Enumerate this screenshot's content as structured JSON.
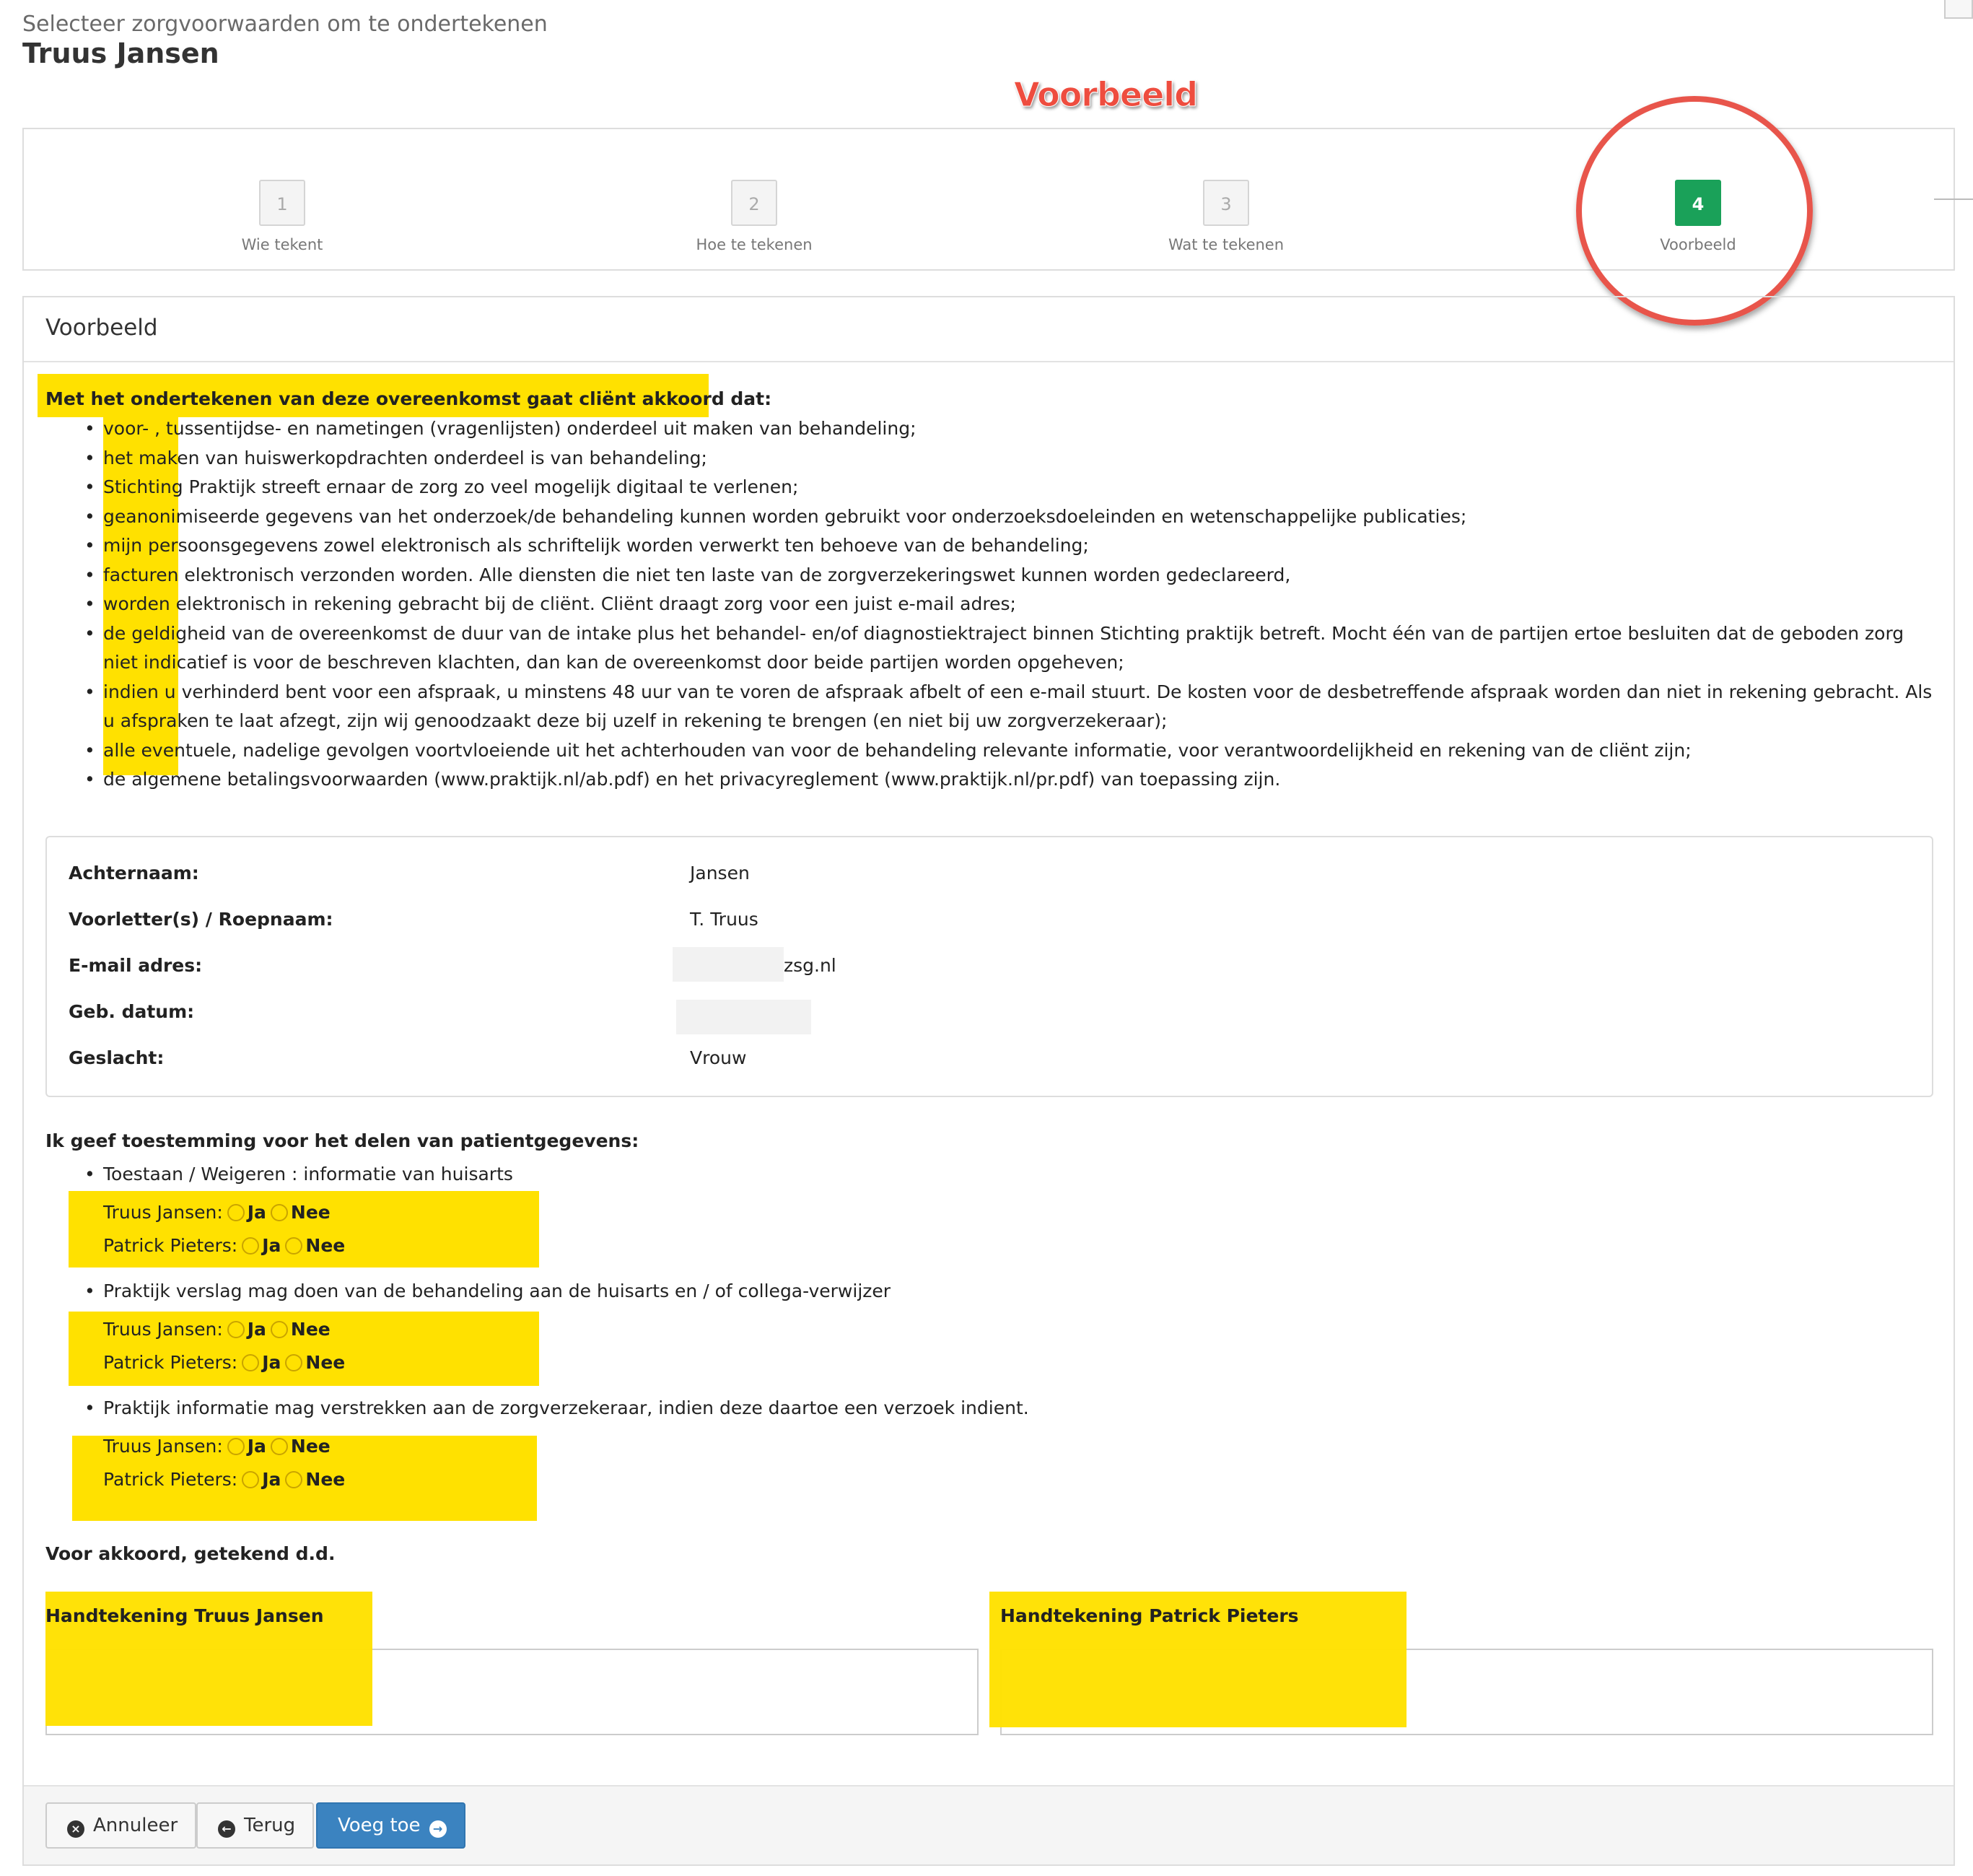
{
  "header": {
    "subtitle": "Selecteer zorgvoorwaarden om te ondertekenen",
    "title": "Truus Jansen",
    "annotation": "Voorbeeld"
  },
  "steps": [
    {
      "number": "1",
      "label": "Wie tekent"
    },
    {
      "number": "2",
      "label": "Hoe te tekenen"
    },
    {
      "number": "3",
      "label": "Wat te tekenen"
    },
    {
      "number": "4",
      "label": "Voorbeeld"
    }
  ],
  "panel": {
    "title": "Voorbeeld",
    "intro": "Met het ondertekenen van deze overeenkomst gaat cliënt akkoord dat:",
    "clauses": [
      "voor- , tussentijdse- en nametingen (vragenlijsten) onderdeel uit maken van behandeling;",
      "het maken van huiswerkopdrachten onderdeel is van behandeling;",
      "Stichting Praktijk streeft ernaar de zorg zo veel mogelijk digitaal te verlenen;",
      "geanonimiseerde gegevens van het onderzoek/de behandeling kunnen worden gebruikt voor onderzoeksdoeleinden en wetenschappelijke publicaties;",
      "mijn persoonsgegevens zowel elektronisch als schriftelijk worden verwerkt ten behoeve van de behandeling;",
      "facturen elektronisch verzonden worden. Alle diensten die niet ten laste van de zorgverzekeringswet kunnen worden gedeclareerd,",
      "worden elektronisch in rekening gebracht bij de cliënt. Cliënt draagt zorg voor een juist e-mail adres;",
      "de geldigheid van de overeenkomst de duur van de intake plus het behandel- en/of diagnostiektraject binnen Stichting praktijk betreft. Mocht één van de partijen ertoe besluiten dat de geboden zorg niet indicatief is voor de beschreven klachten, dan kan de overeenkomst door beide partijen worden opgeheven;",
      "indien u verhinderd bent voor een afspraak, u minstens 48 uur van te voren de afspraak afbelt of een e-mail stuurt. De kosten voor de desbetreffende afspraak worden dan niet in rekening gebracht. Als u afspraken te laat afzegt, zijn wij genoodzaakt deze bij uzelf in rekening te brengen (en niet bij uw zorgverzekeraar);",
      "alle eventuele, nadelige gevolgen voortvloeiende uit het achterhouden van voor de behandeling relevante informatie, voor verantwoordelijkheid en rekening van de cliënt zijn;",
      "de algemene betalingsvoorwaarden (www.praktijk.nl/ab.pdf) en het privacyreglement (www.praktijk.nl/pr.pdf) van toepassing zijn."
    ]
  },
  "client_info": [
    {
      "label": "Achternaam:",
      "value": "Jansen"
    },
    {
      "label": "Voorletter(s) / Roepnaam:",
      "value": "T. Truus"
    },
    {
      "label": "E-mail adres:",
      "value": "zsg.nl"
    },
    {
      "label": "Geb. datum:",
      "value": ""
    },
    {
      "label": "Geslacht:",
      "value": "Vrouw"
    }
  ],
  "consent": {
    "title": "Ik geef toestemming voor het delen van patientgegevens:",
    "items": [
      {
        "text": "Toestaan / Weigeren : informatie van huisarts"
      },
      {
        "text": "Praktijk verslag mag doen van de behandeling aan de huisarts en / of collega-verwijzer"
      },
      {
        "text": "Praktijk informatie mag verstrekken aan de zorgverzekeraar, indien deze daartoe een verzoek indient."
      }
    ],
    "persons": [
      "Truus Jansen:",
      "Patrick Pieters:"
    ],
    "yes": "Ja",
    "no": "Nee"
  },
  "signatures": {
    "agree": "Voor akkoord, getekend d.d.",
    "left_label": "Handtekening Truus Jansen",
    "right_label": "Handtekening Patrick Pieters"
  },
  "buttons": {
    "cancel": "Annuleer",
    "back": "Terug",
    "add": "Voeg toe"
  },
  "colors": {
    "highlight": "#ffe100",
    "active_step": "#1aa159",
    "primary": "#3b83c0",
    "annotation": "#ee4d3f"
  }
}
